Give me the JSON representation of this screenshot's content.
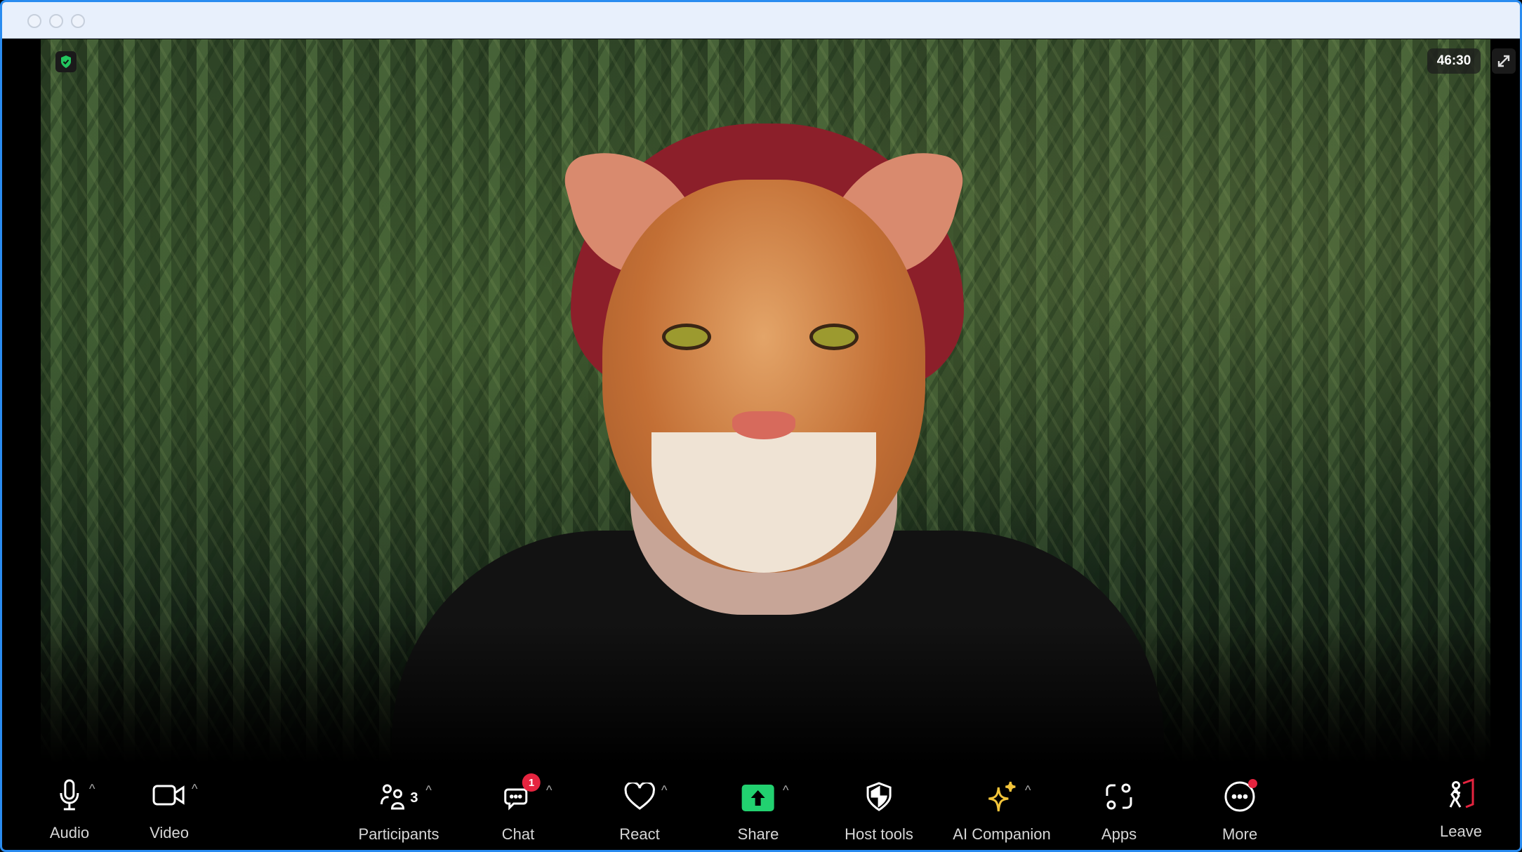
{
  "window": {
    "traffic_lights": [
      "close",
      "minimize",
      "zoom"
    ]
  },
  "meeting": {
    "timer": "46:30",
    "secure_icon": "shield-check-icon",
    "fullscreen_icon": "expand-icon"
  },
  "toolbar": {
    "audio": {
      "label": "Audio"
    },
    "video": {
      "label": "Video"
    },
    "participants": {
      "label": "Participants",
      "count": "3"
    },
    "chat": {
      "label": "Chat",
      "badge": "1"
    },
    "react": {
      "label": "React"
    },
    "share": {
      "label": "Share",
      "color": "#22d170"
    },
    "host_tools": {
      "label": "Host tools"
    },
    "ai_companion": {
      "label": "AI Companion",
      "color": "#f2c43a"
    },
    "apps": {
      "label": "Apps"
    },
    "more": {
      "label": "More"
    },
    "leave": {
      "label": "Leave",
      "color": "#e5243f"
    }
  }
}
